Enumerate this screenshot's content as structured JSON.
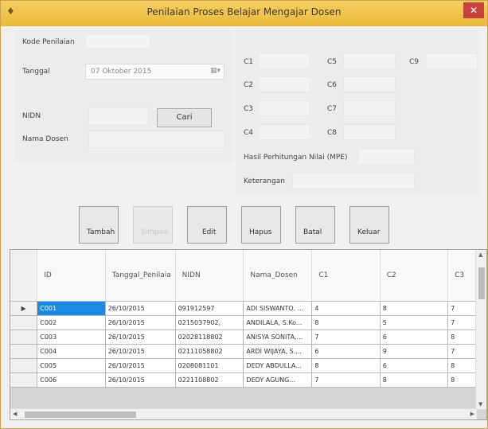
{
  "window": {
    "title": "Penilaian Proses Belajar Mengajar Dosen",
    "close_glyph": "✕",
    "app_icon_glyph": "♦"
  },
  "form": {
    "kode_label": "Kode Penilaian",
    "tanggal_label": "Tanggal",
    "tanggal_value": "07   Oktober   2015",
    "calendar_glyph": "▦▾",
    "nidn_label": "NIDN",
    "nama_label": "Nama Dosen",
    "cari_label": "Cari"
  },
  "criteria": {
    "c1": "C1",
    "c2": "C2",
    "c3": "C3",
    "c4": "C4",
    "c5": "C5",
    "c6": "C6",
    "c7": "C7",
    "c8": "C8",
    "c9": "C9",
    "hasil_label": "Hasil Perhitungan Nilai (MPE)",
    "keterangan_label": "Keterangan"
  },
  "buttons": {
    "tambah": "Tambah",
    "simpan": "Simpan",
    "edit": "Edit",
    "hapus": "Hapus",
    "batal": "Batal",
    "keluar": "Keluar"
  },
  "grid": {
    "columns": [
      "ID",
      "Tanggal_Penilaia",
      "NIDN",
      "Nama_Dosen",
      "C1",
      "C2",
      "C3"
    ],
    "current_row_glyph": "▶",
    "rows": [
      [
        "C001",
        "26/10/2015",
        "091912597",
        "ADI SISWANTO, ...",
        "4",
        "8",
        "7"
      ],
      [
        "C002",
        "26/10/2015",
        "0215037902,",
        "ANDILALA, S.Ko...",
        "8",
        "5",
        "7"
      ],
      [
        "C003",
        "26/10/2015",
        "02028118802",
        "ANISYA SONITA,...",
        "7",
        "6",
        "8"
      ],
      [
        "C004",
        "26/10/2015",
        "02111058802",
        "ARDI WIJAYA, S....",
        "6",
        "9",
        "7"
      ],
      [
        "C005",
        "26/10/2015",
        "0208081101",
        "DEDY ABDULLA...",
        "8",
        "6",
        "8"
      ],
      [
        "C006",
        "26/10/2015",
        "0221108802",
        "DEDY AGUNG...",
        "7",
        "8",
        "8"
      ]
    ]
  },
  "scroll": {
    "up": "▲",
    "down": "▼",
    "left": "◀",
    "right": "▶"
  }
}
